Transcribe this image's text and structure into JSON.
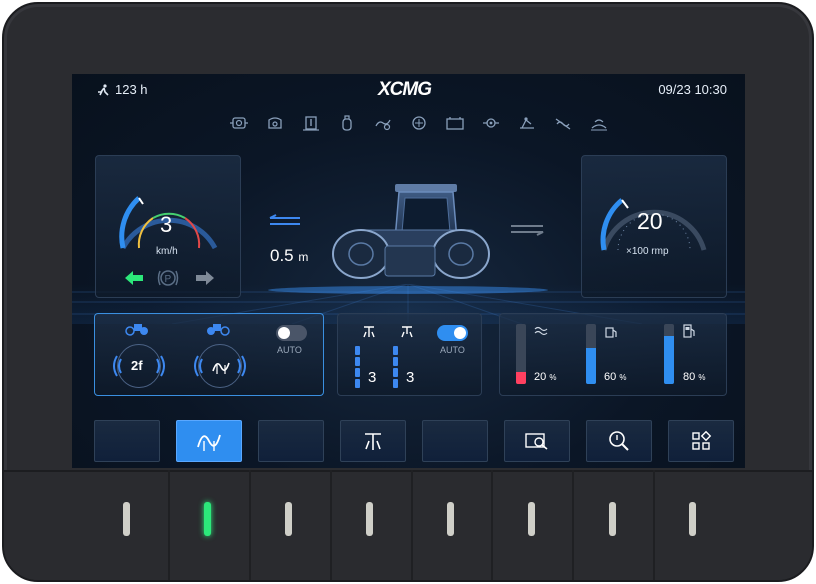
{
  "header": {
    "hours": "123 h",
    "logo": "XCMG",
    "datetime": "09/23 10:30"
  },
  "warning_icons": [
    "engine-icon",
    "oil-can-icon",
    "coolant-temp-icon",
    "filter-icon",
    "oil-filter-icon",
    "hydraulic-icon",
    "air-filter-icon",
    "battery-icon",
    "transmission-icon",
    "parking-brake-icon",
    "no-vibration-icon",
    "seat-belt-icon"
  ],
  "speed_gauge": {
    "value": "3",
    "unit": "km/h"
  },
  "travel": {
    "distance": "0.5",
    "unit": "m"
  },
  "rpm_gauge": {
    "value": "20",
    "unit": "×100 rmp"
  },
  "vibration": {
    "auto_label": "AUTO",
    "front_mode": "2f",
    "auto_on": false
  },
  "sprinkler": {
    "auto_label": "AUTO",
    "front_level": "3",
    "rear_level": "3",
    "auto_on": true
  },
  "levels": [
    {
      "icon": "water-icon",
      "value": 20,
      "label": "20",
      "unit": "%",
      "color": "#ff4060"
    },
    {
      "icon": "fuel-pump-icon",
      "value": 60,
      "label": "60",
      "unit": "%",
      "color": "#2f8ef0"
    },
    {
      "icon": "fuel-icon",
      "value": 80,
      "label": "80",
      "unit": "%",
      "color": "#2f8ef0"
    }
  ],
  "softkeys": [
    "blank",
    "vibration-wave-icon",
    "blank",
    "sprinkler-icon",
    "blank",
    "search-screen-icon",
    "search-icon",
    "menu-grid-icon"
  ],
  "colors": {
    "accent": "#2f8ef0",
    "active_green": "#2ce87a"
  }
}
